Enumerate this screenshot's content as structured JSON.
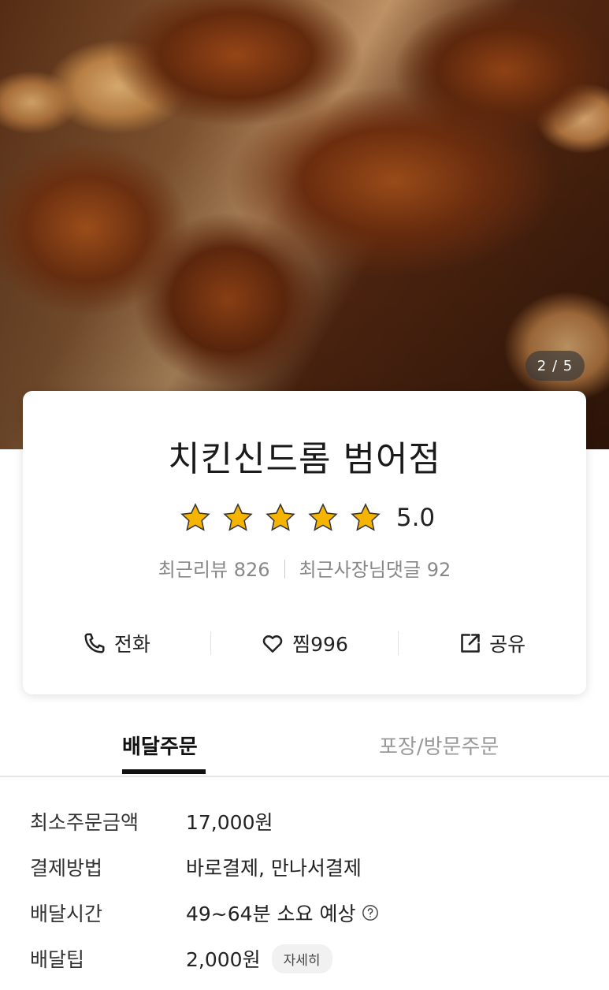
{
  "hero": {
    "image_counter": "2 / 5"
  },
  "store": {
    "name": "치킨신드롬 범어점",
    "rating": 5.0,
    "rating_text": "5.0",
    "recent_reviews": "최근리뷰 826",
    "owner_replies": "최근사장님댓글 92"
  },
  "actions": {
    "call_label": "전화",
    "like_label": "찜996",
    "share_label": "공유"
  },
  "tabs": [
    {
      "label": "배달주문",
      "active": true
    },
    {
      "label": "포장/방문주문",
      "active": false
    }
  ],
  "info": {
    "min_order_label": "최소주문금액",
    "min_order_value": "17,000원",
    "payment_label": "결제방법",
    "payment_value": "바로결제, 만나서결제",
    "delivery_time_label": "배달시간",
    "delivery_time_value": "49~64분 소요 예상",
    "delivery_tip_label": "배달팁",
    "delivery_tip_value": "2,000원",
    "detail_button": "자세히"
  },
  "colors": {
    "star": "#f5b400",
    "accent_tab": "#111111"
  },
  "icons": [
    "phone-icon",
    "heart-icon",
    "share-icon",
    "star-icon",
    "help-icon"
  ]
}
